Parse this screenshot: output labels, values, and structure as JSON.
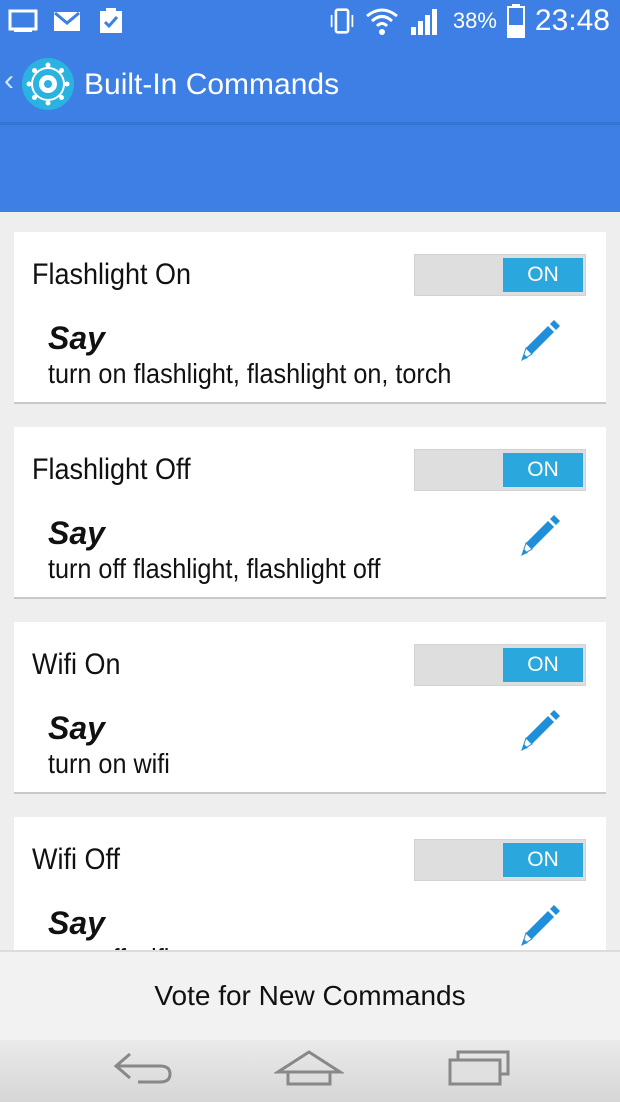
{
  "status_bar": {
    "battery_percent": "38%",
    "time": "23:48",
    "left_icons": [
      "cast-icon",
      "gmail-icon",
      "clipboard-check-icon"
    ],
    "right_icons": [
      "vibrate-icon",
      "wifi-icon",
      "signal-icon",
      "battery-icon"
    ]
  },
  "header": {
    "title": "Built-In Commands",
    "back_icon": "chevron-left-icon",
    "logo_icon": "app-logo-icon"
  },
  "commands": [
    {
      "title": "Flashlight On",
      "toggle_label": "ON",
      "say_label": "Say",
      "phrases": "turn on flashlight, flashlight on, torch"
    },
    {
      "title": "Flashlight Off",
      "toggle_label": "ON",
      "say_label": "Say",
      "phrases": "turn off flashlight, flashlight off"
    },
    {
      "title": "Wifi On",
      "toggle_label": "ON",
      "say_label": "Say",
      "phrases": "turn on wifi"
    },
    {
      "title": "Wifi Off",
      "toggle_label": "ON",
      "say_label": "Say",
      "phrases": "turn off wifi"
    }
  ],
  "footer": {
    "vote_label": "Vote for New Commands"
  },
  "nav_bar": {
    "buttons": [
      "back-icon",
      "home-icon",
      "recents-icon"
    ]
  },
  "colors": {
    "header": "#3d7fe4",
    "toggle_on": "#2aa7dc",
    "edit_icon": "#1e8fd8"
  }
}
